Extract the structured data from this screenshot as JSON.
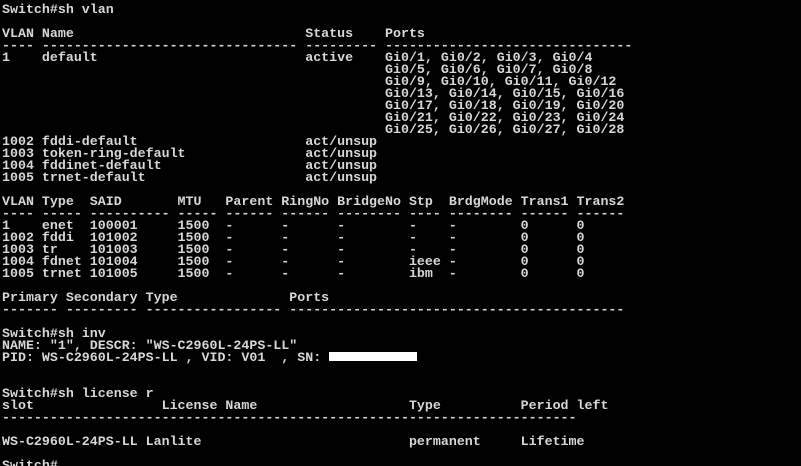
{
  "terminal": {
    "colors": {
      "background": "#000000",
      "foreground": "#d7d7d7",
      "redaction": "#ffffff"
    },
    "lines": [
      "Switch#sh vlan",
      "",
      "VLAN Name                             Status    Ports",
      "---- -------------------------------- --------- -------------------------------",
      "1    default                          active    Gi0/1, Gi0/2, Gi0/3, Gi0/4",
      "                                                Gi0/5, Gi0/6, Gi0/7, Gi0/8",
      "                                                Gi0/9, Gi0/10, Gi0/11, Gi0/12",
      "                                                Gi0/13, Gi0/14, Gi0/15, Gi0/16",
      "                                                Gi0/17, Gi0/18, Gi0/19, Gi0/20",
      "                                                Gi0/21, Gi0/22, Gi0/23, Gi0/24",
      "                                                Gi0/25, Gi0/26, Gi0/27, Gi0/28",
      "1002 fddi-default                     act/unsup",
      "1003 token-ring-default               act/unsup",
      "1004 fddinet-default                  act/unsup",
      "1005 trnet-default                    act/unsup",
      "",
      "VLAN Type  SAID       MTU   Parent RingNo BridgeNo Stp  BrdgMode Trans1 Trans2",
      "---- ----- ---------- ----- ------ ------ -------- ---- -------- ------ ------",
      "1    enet  100001     1500  -      -      -        -    -        0      0",
      "1002 fddi  101002     1500  -      -      -        -    -        0      0",
      "1003 tr    101003     1500  -      -      -        -    -        0      0",
      "1004 fdnet 101004     1500  -      -      -        ieee -        0      0",
      "1005 trnet 101005     1500  -      -      -        ibm  -        0      0",
      "",
      "Primary Secondary Type              Ports",
      "------- --------- ----------------- ------------------------------------------",
      "",
      "Switch#sh inv",
      "NAME: \"1\", DESCR: \"WS-C2960L-24PS-LL\"",
      "PID: WS-C2960L-24PS-LL , VID: V01  , SN: ",
      "",
      "",
      "Switch#sh license r",
      "slot                License Name                   Type          Period left",
      "------------------------------------------------------------------------",
      "",
      "WS-C2960L-24PS-LL Lanlite                          permanent     Lifetime",
      "",
      "Switch#"
    ],
    "redacted_line_index": 29
  }
}
